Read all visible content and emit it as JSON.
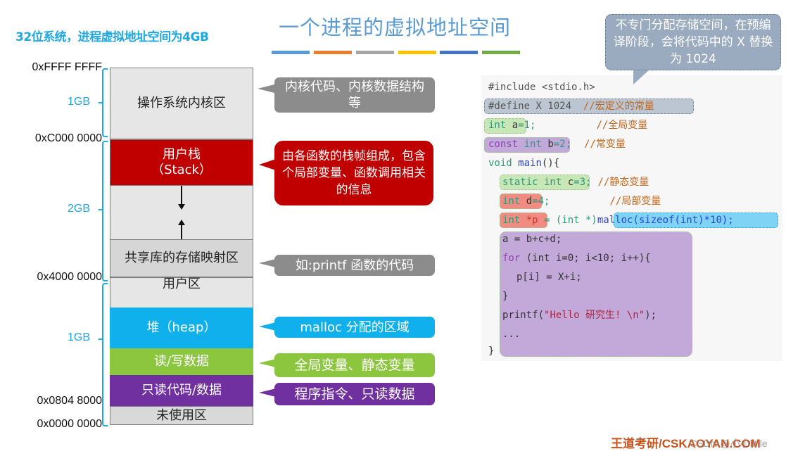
{
  "subtitle": "32位系统，进程虚拟地址空间为4GB",
  "title": "一个进程的虚拟地址空间",
  "title_bar_colors": [
    "#5b9bd5",
    "#ed7d31",
    "#a5a5a5",
    "#ffc000",
    "#4472c4",
    "#70ad47"
  ],
  "addresses": {
    "top": "0xFFFF FFFF",
    "kernel_start": "0xC000 0000",
    "user_mid": "0x4000 0000",
    "code_start": "0x0804 8000",
    "bottom": "0x0000 0000"
  },
  "sizes": {
    "kernel": "1GB",
    "upper_user": "2GB",
    "lower_user": "1GB"
  },
  "segments": {
    "kernel": "操作系统内核区",
    "stack_line1": "用户栈",
    "stack_line2": "（Stack）",
    "shared_lib": "共享库的存储映射区",
    "user_area": "用户区",
    "heap": "堆（heap）",
    "rw_data": "读/写数据",
    "ro_code": "只读代码/数据",
    "unused": "未使用区"
  },
  "segment_colors": {
    "kernel": "#e6e6e6",
    "stack": "#c00000",
    "gap": "#e6e6e6",
    "heap": "#10b0ec",
    "rw_data": "#8cc63f",
    "ro_code": "#7030a0",
    "unused": "#d9d9d9"
  },
  "callouts": {
    "kernel": "内核代码、内核数据结构等",
    "stack": "由各函数的栈帧组成，包含个局部变量、函数调用相关的信息",
    "shared_lib": "如:printf 函数的代码",
    "heap": "malloc 分配的区域",
    "rw_data": "全局变量、静态变量",
    "ro_code": "程序指令、只读数据"
  },
  "note": "不专门分配存储空间，在预编译阶段，会将代码中的 X 替换为 1024",
  "code": {
    "l1": "#include <stdio.h>",
    "l2_code": "#define X 1024  ",
    "l2_comment": "//宏定义的常量",
    "l3_decl": "int ",
    "l3_var": "a",
    "l3_rest": "=1;",
    "l3_comment": "//全局变量",
    "l4_kw": "const",
    "l4_decl": " int ",
    "l4_var": "b",
    "l4_rest": "=2;",
    "l4_comment": "//常变量",
    "l5_void": "void ",
    "l5_main": "main",
    "l5_rest": "(){",
    "l6_decl": "static int ",
    "l6_var": "c",
    "l6_rest": "=3;",
    "l6_comment": "//静态变量",
    "l7_decl": "int ",
    "l7_var": "d",
    "l7_rest": "=4;",
    "l7_comment": "//局部变量",
    "l8_decl": "int ",
    "l8_var": "*p",
    "l8_mid": " = (int *)",
    "l8_malloc": "malloc(sizeof(int)*10);",
    "l9": "a = b+c+d;",
    "l10_for": "for",
    "l10_rest": " (int i=0; i<10; i++){",
    "l11": "p[i] = X+i;",
    "l12": "}",
    "l13_fn": "printf(",
    "l13_str": "\"Hello 研究生! \\n\"",
    "l13_end": ");",
    "l14": "...",
    "l15": "}"
  },
  "footer": "王道考研/CSKAOYAN.COM",
  "watermark": "CSDN @小小little"
}
